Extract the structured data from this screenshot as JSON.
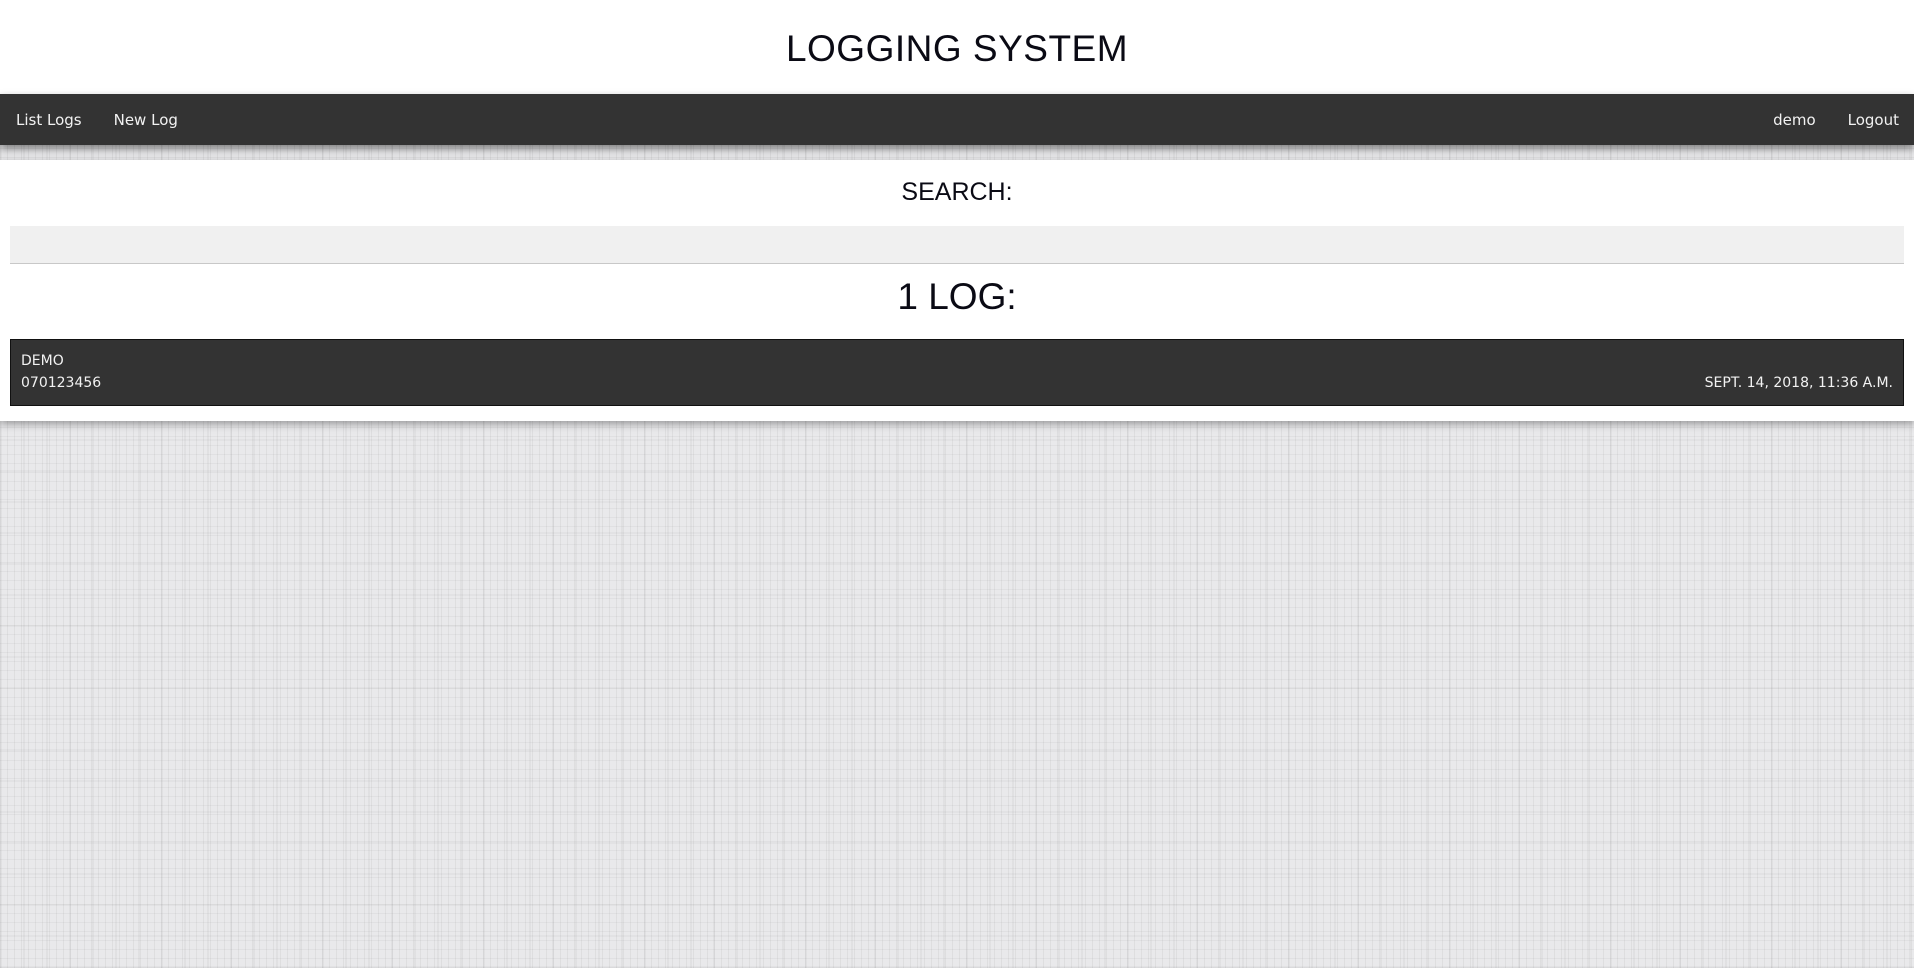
{
  "header": {
    "title": "LOGGING SYSTEM"
  },
  "nav": {
    "left": [
      {
        "label": "List Logs"
      },
      {
        "label": "New Log"
      }
    ],
    "right": [
      {
        "label": "demo"
      },
      {
        "label": "Logout"
      }
    ]
  },
  "search": {
    "heading": "SEARCH:",
    "value": "",
    "placeholder": ""
  },
  "logs": {
    "heading": "1 LOG:",
    "items": [
      {
        "name": "DEMO",
        "phone": "070123456",
        "date": "SEPT. 14, 2018, 11:36 A.M."
      }
    ]
  },
  "colors": {
    "navbar": "#333333",
    "log_item": "#333333",
    "panel": "#ffffff",
    "search_field": "#f0f0f0",
    "nav_text": "#f2f2f2"
  }
}
